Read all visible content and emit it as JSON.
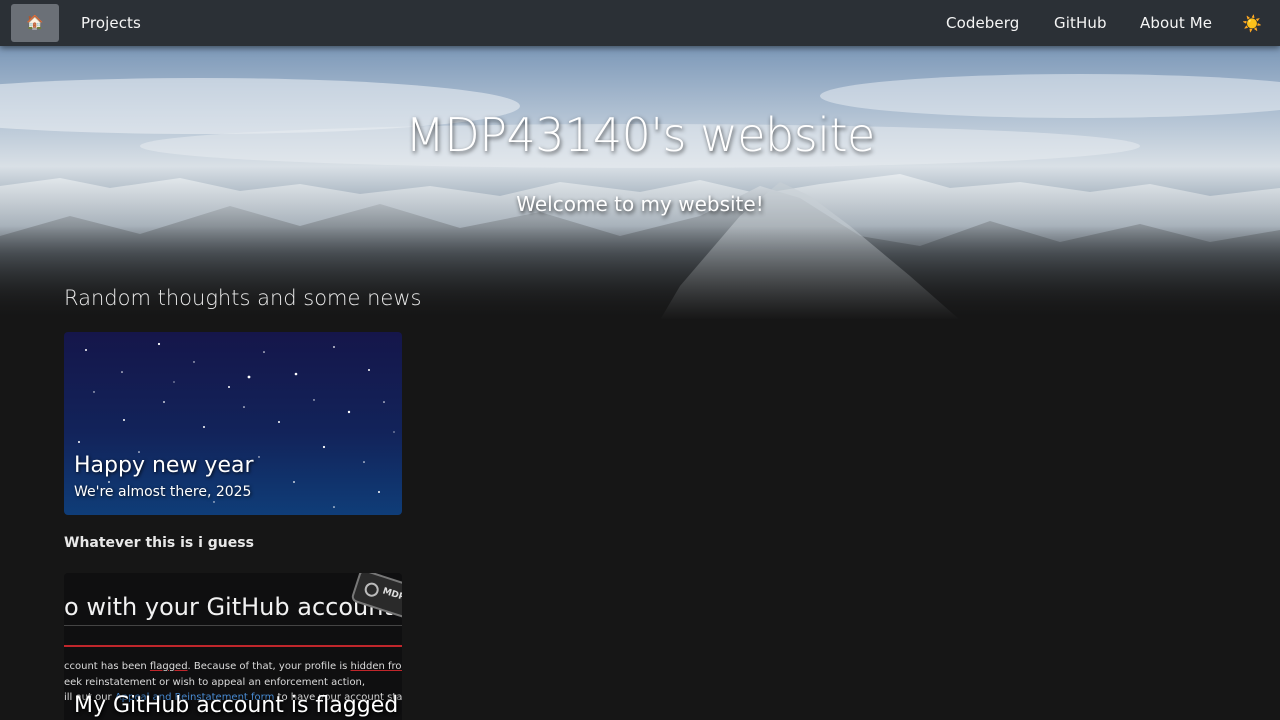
{
  "nav": {
    "home_icon": "house-emoji",
    "home_glyph": "🏠",
    "projects": "Projects",
    "codeberg": "Codeberg",
    "github": "GitHub",
    "about": "About Me",
    "theme_icon": "sun-emoji",
    "theme_glyph": "☀️"
  },
  "hero": {
    "title": "MDP43140's website",
    "subtitle": "Welcome to my website!"
  },
  "section": {
    "heading": "Random thoughts and some news"
  },
  "posts": [
    {
      "title": "Happy new year",
      "subtitle": "We're almost there, 2025"
    },
    {
      "caption": "Whatever this is i guess"
    },
    {
      "title": "My GitHub account is flagged",
      "screenshot": {
        "heading": "o with your GitHub account",
        "line1_a": "ccount has been ",
        "line1_b": "flagged",
        "line1_c": ". Because of that, your profile is ",
        "line1_d": "hidden from the p",
        "line2": "eek reinstatement or wish to appeal an enforcement action,",
        "line3_a": "ill out our ",
        "line3_link": "Appeal and Reinstatement form",
        "line3_c": " to have your account status re",
        "badge": "MDP"
      }
    }
  ],
  "colors": {
    "navbar": "#2b3036",
    "home_button": "#6b7077",
    "page_background": "#161616",
    "link_blue": "#4a8fd9",
    "flag_red": "#c0262b"
  }
}
